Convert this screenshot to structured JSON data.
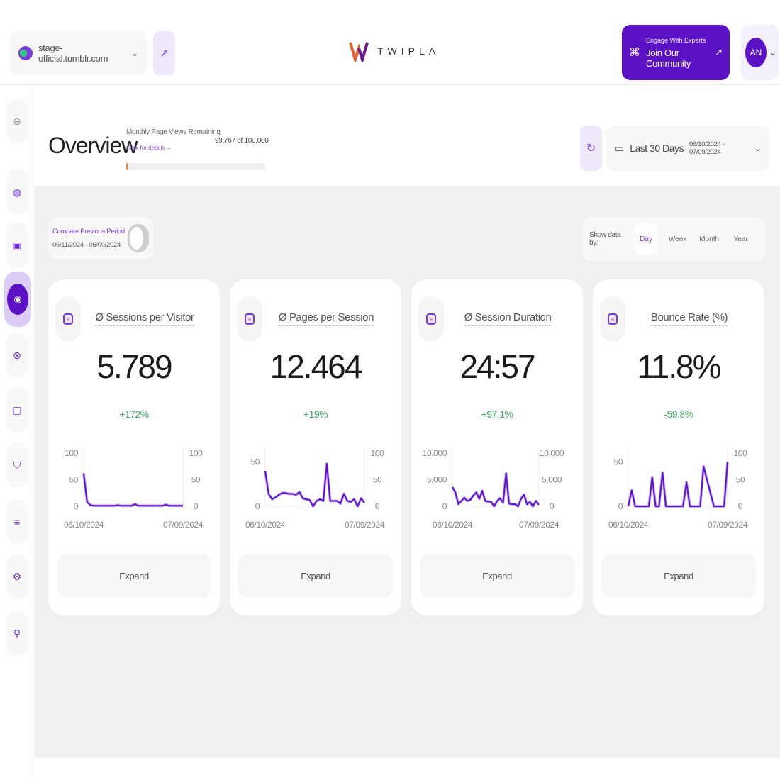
{
  "topbar": {
    "site_name": "stage-official.tumblr.com",
    "logo_text": "TWIPLA",
    "community": {
      "small": "Engage With Experts",
      "big": "Join Our Community"
    },
    "user_initials": "AN"
  },
  "sidebar": {
    "items": [
      {
        "name": "collapse",
        "icon": "arrow-left-circle-icon",
        "glyph": "⊖"
      },
      {
        "name": "website-analytics",
        "icon": "globe-icon",
        "glyph": "◍"
      },
      {
        "name": "shop",
        "icon": "bag-icon",
        "glyph": "▣"
      },
      {
        "name": "visitor-behavior",
        "icon": "behavior-icon",
        "glyph": "◉",
        "active": true
      },
      {
        "name": "visitor-insights",
        "icon": "face-scan-icon",
        "glyph": "⊛"
      },
      {
        "name": "visitor-communication",
        "icon": "chat-icon",
        "glyph": "▢"
      },
      {
        "name": "privacy",
        "icon": "shield-check-icon",
        "glyph": "⛉"
      },
      {
        "name": "database",
        "icon": "database-icon",
        "glyph": "≡"
      },
      {
        "name": "settings",
        "icon": "gear-icon",
        "glyph": "⚙"
      },
      {
        "name": "location",
        "icon": "location-icon",
        "glyph": "⚲"
      }
    ]
  },
  "header": {
    "title": "Overview",
    "quota": {
      "label": "Monthly Page Views Remaining",
      "link": "Click for details →",
      "value": "99,767 of 100,000",
      "used_fraction": 0.00233
    },
    "date_label": "Last 30 Days",
    "date_range": "06/10/2024 - 07/09/2024"
  },
  "compare": {
    "title": "Compare Previous Period",
    "range": "05/11/2024 - 06/09/2024",
    "enabled": false
  },
  "show_by": {
    "label": "Show data by:",
    "options": [
      "Day",
      "Week",
      "Month",
      "Year"
    ],
    "selected": "Day"
  },
  "cards": [
    {
      "title": "Ø Sessions per Visitor",
      "value": "5.789",
      "change": "+172%",
      "expand": "Expand"
    },
    {
      "title": "Ø Pages per Session",
      "value": "12.464",
      "change": "+19%",
      "expand": "Expand"
    },
    {
      "title": "Ø Session Duration",
      "value": "24:57",
      "change": "+97.1%",
      "expand": "Expand"
    },
    {
      "title": "Bounce Rate (%)",
      "value": "11.8%",
      "change": "-59.8%",
      "expand": "Expand"
    }
  ],
  "chart_data": [
    {
      "type": "line",
      "title": "Ø Sessions per Visitor",
      "x_start": "06/10/2024",
      "x_end": "07/09/2024",
      "left_ticks": [
        "0",
        "50",
        "100"
      ],
      "right_ticks": [
        "0",
        "50",
        "100"
      ],
      "ylim": [
        0,
        100
      ],
      "values": [
        62,
        8,
        2,
        1,
        1,
        1,
        1,
        1,
        1,
        1,
        2,
        1,
        1,
        1,
        1,
        4,
        1,
        1,
        1,
        1,
        1,
        1,
        1,
        1,
        3,
        1,
        1,
        1,
        1,
        1
      ]
    },
    {
      "type": "line",
      "title": "Ø Pages per Session",
      "x_start": "06/10/2024",
      "x_end": "07/09/2024",
      "left_ticks": [
        "0",
        "50"
      ],
      "right_ticks": [
        "0",
        "50",
        "100"
      ],
      "ylim": [
        0,
        60
      ],
      "values": [
        40,
        14,
        8,
        10,
        13,
        15,
        15,
        14,
        14,
        13,
        16,
        9,
        8,
        7,
        0,
        6,
        8,
        6,
        48,
        6,
        6,
        6,
        3,
        14,
        6,
        5,
        8,
        0,
        9,
        4
      ]
    },
    {
      "type": "line",
      "title": "Ø Session Duration",
      "x_start": "06/10/2024",
      "x_end": "07/09/2024",
      "left_ticks": [
        "0",
        "5,000",
        "10,000"
      ],
      "right_ticks": [
        "0",
        "5,000",
        "10,000"
      ],
      "ylim": [
        0,
        10000
      ],
      "values": [
        3600,
        2600,
        400,
        1000,
        1600,
        1000,
        1200,
        2000,
        2600,
        1400,
        2900,
        1000,
        900,
        800,
        0,
        1000,
        1500,
        700,
        6200,
        500,
        400,
        400,
        0,
        1400,
        2200,
        400,
        800,
        0,
        1000,
        300
      ]
    },
    {
      "type": "line",
      "title": "Bounce Rate (%)",
      "x_start": "06/10/2024",
      "x_end": "07/09/2024",
      "left_ticks": [
        "0",
        "50"
      ],
      "right_ticks": [
        "0",
        "50",
        "100"
      ],
      "ylim": [
        0,
        60
      ],
      "values": [
        0,
        18,
        0,
        0,
        0,
        0,
        0,
        33,
        0,
        0,
        38,
        0,
        0,
        0,
        0,
        0,
        0,
        27,
        0,
        0,
        0,
        0,
        45,
        30,
        15,
        0,
        0,
        0,
        0,
        50
      ]
    }
  ],
  "colors": {
    "accent": "#5b12c4",
    "accent_light": "#7a3ed8",
    "positive": "#3faa66",
    "line": "#5b12c4"
  }
}
